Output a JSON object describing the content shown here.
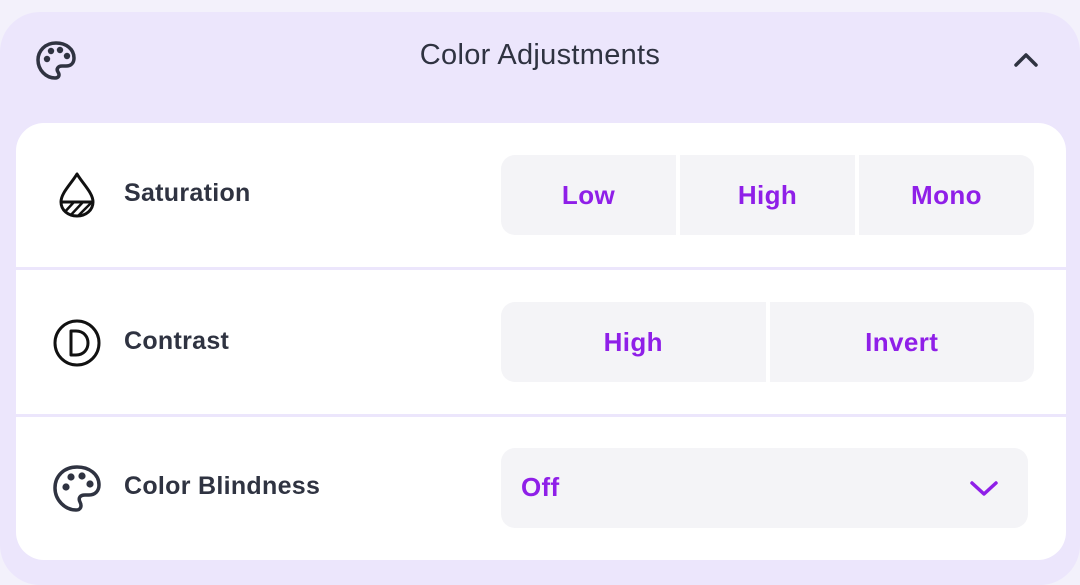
{
  "header": {
    "title": "Color Adjustments",
    "icon": "palette-icon",
    "collapse_icon": "chevron-up-icon"
  },
  "rows": [
    {
      "label": "Saturation",
      "icon": "drop-icon",
      "options": [
        "Low",
        "High",
        "Mono"
      ]
    },
    {
      "label": "Contrast",
      "icon": "contrast-icon",
      "options": [
        "High",
        "Invert"
      ]
    },
    {
      "label": "Color Blindness",
      "icon": "palette-icon",
      "select_value": "Off",
      "select_icon": "chevron-down-icon"
    }
  ],
  "colors": {
    "accent": "#8f1fe8",
    "panel_bg": "#ece6fc",
    "card_bg": "#ffffff",
    "button_bg": "#f4f4f7",
    "text": "#2f3341"
  }
}
